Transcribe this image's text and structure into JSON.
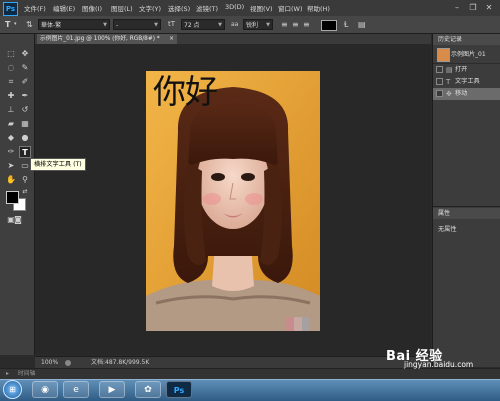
{
  "menubar": {
    "logo": "Ps",
    "items": [
      "文件(F)",
      "编辑(E)",
      "图像(I)",
      "图层(L)",
      "文字(Y)",
      "选择(S)",
      "滤镜(T)",
      "3D(D)",
      "视图(V)",
      "窗口(W)",
      "帮助(H)"
    ],
    "win_min": "–",
    "win_restore": "❐",
    "win_close": "✕"
  },
  "options": {
    "font_family": "華体-繁",
    "font_style": "-",
    "font_size": "72 点",
    "antialias": "锐利",
    "text_color": "#000000"
  },
  "tooltip": "横排文字工具 (T)",
  "document": {
    "tab_title": "示例图片_01.jpg @ 100% (你好, RGB/8#) *",
    "tab_close": "×",
    "overlay_text": "你好"
  },
  "statusbar": {
    "zoom": "100%",
    "doc_info": "文档:487.8K/999.5K"
  },
  "minibar": {
    "label": "时间轴"
  },
  "history": {
    "tab": "历史记录",
    "snapshot": "示例图片_01",
    "items": [
      {
        "label": "打开",
        "icon": "document-icon"
      },
      {
        "label": "文字工具",
        "icon": "type-icon"
      },
      {
        "label": "移动",
        "icon": "move-icon"
      }
    ]
  },
  "properties": {
    "tab": "属性",
    "value": "无属性"
  },
  "taskbar": {
    "apps": [
      "chrome",
      "browser",
      "media",
      "photoshop"
    ],
    "ps_label": "Ps"
  },
  "watermark": {
    "logo": "Bai 经验",
    "url": "jingyan.baidu.com"
  },
  "colors": {
    "accent": "#31a8ff",
    "photo_bg": "#e6a93c"
  }
}
